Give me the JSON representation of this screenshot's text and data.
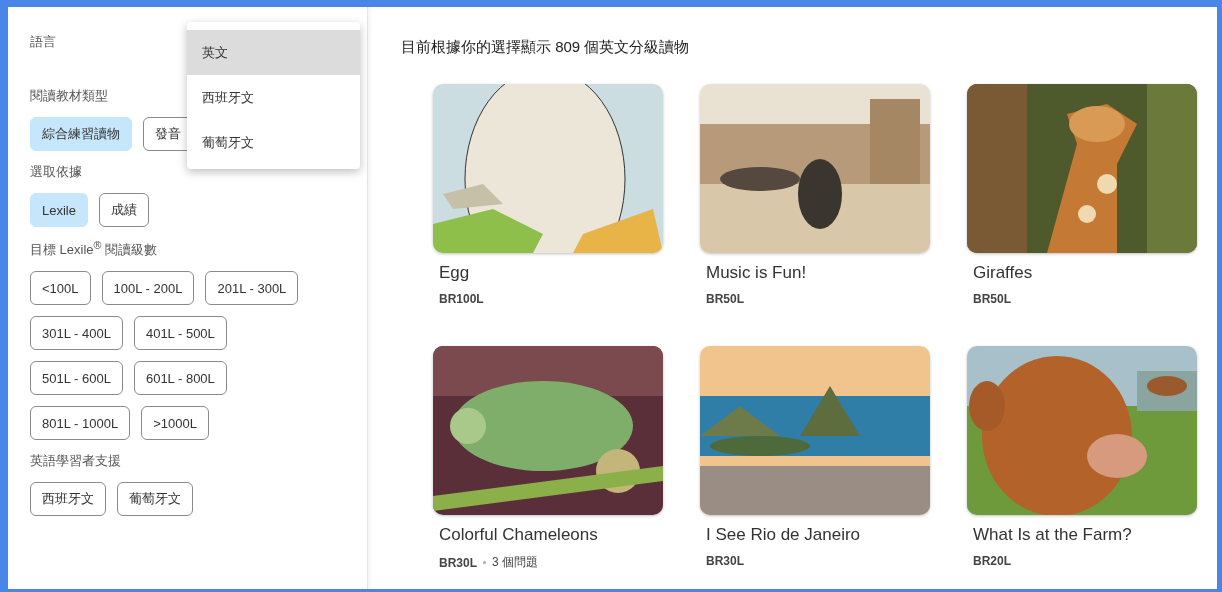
{
  "language": {
    "label": "語言",
    "options": [
      {
        "label": "英文",
        "selected": true
      },
      {
        "label": "西班牙文",
        "selected": false
      },
      {
        "label": "葡萄牙文",
        "selected": false
      }
    ]
  },
  "filters": [
    {
      "label": "閱讀教材類型",
      "chips": [
        {
          "label": "綜合練習讀物",
          "selected": true
        },
        {
          "label": "發音",
          "selected": false
        }
      ]
    },
    {
      "label": "選取依據",
      "chips": [
        {
          "label": "Lexile",
          "selected": true
        },
        {
          "label": "成績",
          "selected": false
        }
      ]
    },
    {
      "label": "目標 Lexile$^{®}$ 閱讀級數",
      "chips": [
        {
          "label": "<100L",
          "selected": false
        },
        {
          "label": "100L - 200L",
          "selected": false
        },
        {
          "label": "201L - 300L",
          "selected": false
        },
        {
          "label": "301L - 400L",
          "selected": false
        },
        {
          "label": "401L - 500L",
          "selected": false
        },
        {
          "label": "501L - 600L",
          "selected": false
        },
        {
          "label": "601L - 800L",
          "selected": false
        },
        {
          "label": "801L - 1000L",
          "selected": false
        },
        {
          "label": ">1000L",
          "selected": false
        }
      ]
    },
    {
      "label": "英語學習者支援",
      "chips": [
        {
          "label": "西班牙文",
          "selected": false
        },
        {
          "label": "葡萄牙文",
          "selected": false
        }
      ]
    }
  ],
  "results": {
    "summary": "目前根據你的選擇顯示 809 個英文分級讀物",
    "books": [
      {
        "title": "Egg",
        "level": "BR100L"
      },
      {
        "title": "Music is Fun!",
        "level": "BR50L"
      },
      {
        "title": "Giraffes",
        "level": "BR50L"
      },
      {
        "title": "Colorful Chameleons",
        "level": "BR30L",
        "questions": "3 個問題"
      },
      {
        "title": "I See Rio de Janeiro",
        "level": "BR30L"
      },
      {
        "title": "What Is at the Farm?",
        "level": "BR20L"
      }
    ]
  }
}
